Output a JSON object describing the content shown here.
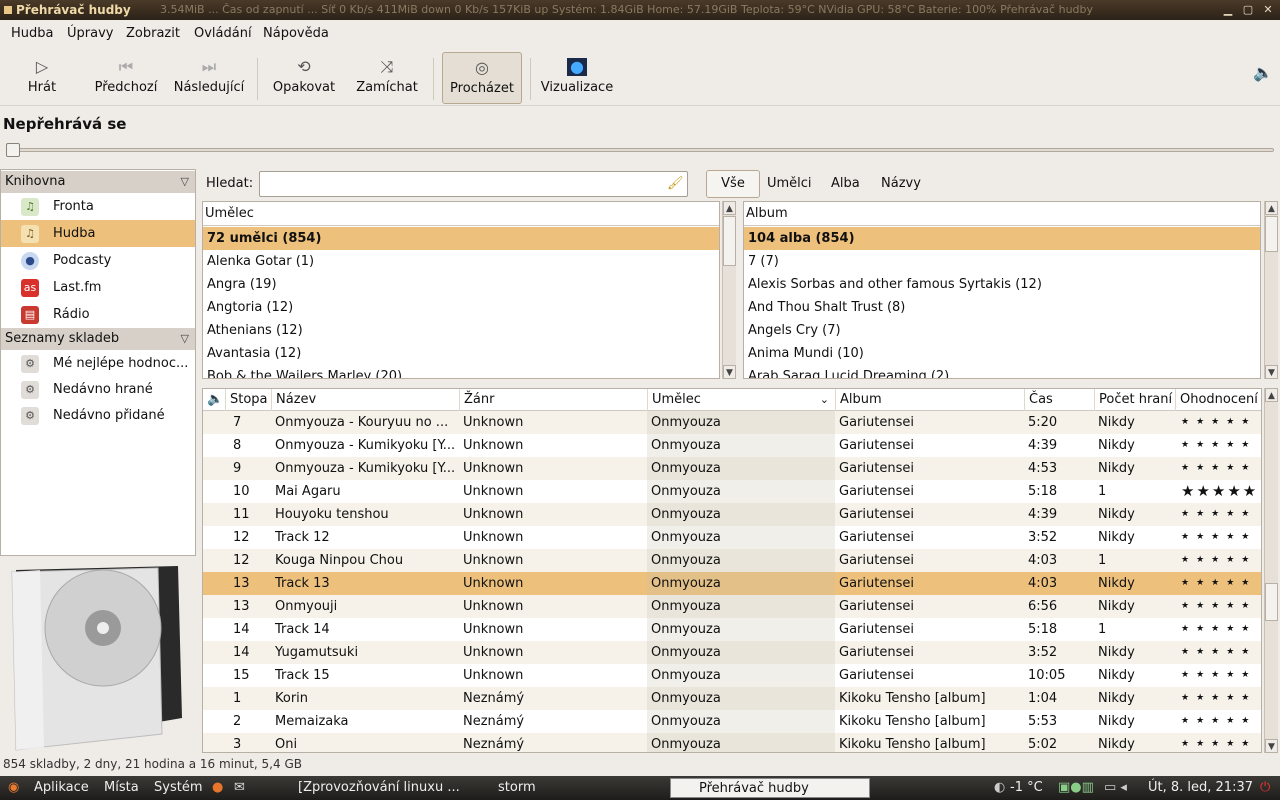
{
  "window": {
    "title": "Přehrávač hudby",
    "system_text": "3.54MiB ... Čas od zapnutí ... Síť 0 Kb/s 411MiB down  0 Kb/s 157KiB up   Systém: 1.84GiB  Home: 57.19GiB  Teplota: 59°C  NVidia GPU: 58°C  Baterie: 100%  Přehrávač hudby"
  },
  "menu": [
    "Hudba",
    "Úpravy",
    "Zobrazit",
    "Ovládání",
    "Nápověda"
  ],
  "toolbar": {
    "play": "Hrát",
    "prev": "Předchozí",
    "next": "Následující",
    "repeat": "Opakovat",
    "shuffle": "Zamíchat",
    "browse": "Procházet",
    "visualize": "Vizualizace"
  },
  "now_playing": "Nepřehrává se",
  "sidebar": {
    "library_header": "Knihovna",
    "library": [
      {
        "label": "Fronta",
        "icon": "queue-icon"
      },
      {
        "label": "Hudba",
        "icon": "music-icon"
      },
      {
        "label": "Podcasty",
        "icon": "podcast-icon"
      },
      {
        "label": "Last.fm",
        "icon": "lastfm-icon"
      },
      {
        "label": "Rádio",
        "icon": "radio-icon"
      }
    ],
    "playlists_header": "Seznamy skladeb",
    "playlists": [
      {
        "label": "Mé nejlépe hodnoc...",
        "icon": "gear-icon"
      },
      {
        "label": "Nedávno hrané",
        "icon": "gear-icon"
      },
      {
        "label": "Nedávno přidané",
        "icon": "gear-icon"
      }
    ]
  },
  "search": {
    "label": "Hledat:",
    "value": "",
    "placeholder": ""
  },
  "filter_tabs": {
    "all": "Vše",
    "artists": "Umělci",
    "albums": "Alba",
    "titles": "Názvy"
  },
  "artist_pane": {
    "header": "Umělec",
    "rows": [
      "72 umělci (854)",
      "Alenka Gotar (1)",
      "Angra (19)",
      "Angtoria (12)",
      "Athenians (12)",
      "Avantasia (12)",
      "Bob & the Wailers Marley (20)"
    ]
  },
  "album_pane": {
    "header": "Album",
    "rows": [
      "104 alba (854)",
      "7 (7)",
      "Alexis Sorbas and other famous Syrtakis (12)",
      "And Thou Shalt Trust (8)",
      "Angels Cry (7)",
      "Anima Mundi (10)",
      "Arab Saraq Lucid Dreaming (2)"
    ]
  },
  "track_columns": {
    "track": "Stopa",
    "title": "Název",
    "genre": "Žánr",
    "artist": "Umělec",
    "album": "Album",
    "time": "Čas",
    "plays": "Počet hraní",
    "rating": "Ohodnocení"
  },
  "tracks": [
    {
      "n": "7",
      "title": "Onmyouza - Kouryuu no ...",
      "genre": "Unknown",
      "artist": "Onmyouza",
      "album": "Gariutensei",
      "time": "5:20",
      "plays": "Nikdy",
      "rating": 0
    },
    {
      "n": "8",
      "title": "Onmyouza - Kumikyoku [Y...",
      "genre": "Unknown",
      "artist": "Onmyouza",
      "album": "Gariutensei",
      "time": "4:39",
      "plays": "Nikdy",
      "rating": 0
    },
    {
      "n": "9",
      "title": "Onmyouza - Kumikyoku [Y...",
      "genre": "Unknown",
      "artist": "Onmyouza",
      "album": "Gariutensei",
      "time": "4:53",
      "plays": "Nikdy",
      "rating": 0
    },
    {
      "n": "10",
      "title": "Mai Agaru",
      "genre": "Unknown",
      "artist": "Onmyouza",
      "album": "Gariutensei",
      "time": "5:18",
      "plays": "1",
      "rating": 5
    },
    {
      "n": "11",
      "title": "Houyoku tenshou",
      "genre": "Unknown",
      "artist": "Onmyouza",
      "album": "Gariutensei",
      "time": "4:39",
      "plays": "Nikdy",
      "rating": 0
    },
    {
      "n": "12",
      "title": "Track 12",
      "genre": "Unknown",
      "artist": "Onmyouza",
      "album": "Gariutensei",
      "time": "3:52",
      "plays": "Nikdy",
      "rating": 0
    },
    {
      "n": "12",
      "title": "Kouga Ninpou Chou",
      "genre": "Unknown",
      "artist": "Onmyouza",
      "album": "Gariutensei",
      "time": "4:03",
      "plays": "1",
      "rating": 0
    },
    {
      "n": "13",
      "title": "Track 13",
      "genre": "Unknown",
      "artist": "Onmyouza",
      "album": "Gariutensei",
      "time": "4:03",
      "plays": "Nikdy",
      "rating": 0
    },
    {
      "n": "13",
      "title": "Onmyouji",
      "genre": "Unknown",
      "artist": "Onmyouza",
      "album": "Gariutensei",
      "time": "6:56",
      "plays": "Nikdy",
      "rating": 0
    },
    {
      "n": "14",
      "title": "Track 14",
      "genre": "Unknown",
      "artist": "Onmyouza",
      "album": "Gariutensei",
      "time": "5:18",
      "plays": "1",
      "rating": 0
    },
    {
      "n": "14",
      "title": "Yugamutsuki",
      "genre": "Unknown",
      "artist": "Onmyouza",
      "album": "Gariutensei",
      "time": "3:52",
      "plays": "Nikdy",
      "rating": 0
    },
    {
      "n": "15",
      "title": "Track 15",
      "genre": "Unknown",
      "artist": "Onmyouza",
      "album": "Gariutensei",
      "time": "10:05",
      "plays": "Nikdy",
      "rating": 0
    },
    {
      "n": "1",
      "title": "Korin",
      "genre": "Neznámý",
      "artist": "Onmyouza",
      "album": "Kikoku Tensho [album]",
      "time": "1:04",
      "plays": "Nikdy",
      "rating": 0
    },
    {
      "n": "2",
      "title": "Memaizaka",
      "genre": "Neznámý",
      "artist": "Onmyouza",
      "album": "Kikoku Tensho [album]",
      "time": "5:53",
      "plays": "Nikdy",
      "rating": 0
    },
    {
      "n": "3",
      "title": "Oni",
      "genre": "Neznámý",
      "artist": "Onmyouza",
      "album": "Kikoku Tensho [album]",
      "time": "5:02",
      "plays": "Nikdy",
      "rating": 0
    }
  ],
  "selected_track_index": 7,
  "status": "854 skladby, 2 dny, 21 hodina a 16 minut, 5,4 GB",
  "taskbar": {
    "apps": "Aplikace",
    "places": "Místa",
    "system": "Systém",
    "task1": "[Zprovozňování linuxu ...",
    "task2": "storm",
    "task3": "Přehrávač hudby",
    "temp": "-1 °C",
    "clock": "Út,  8. led, 21:37"
  },
  "colors": {
    "selection": "#edc07c",
    "titlebar": "#3a2e20"
  }
}
